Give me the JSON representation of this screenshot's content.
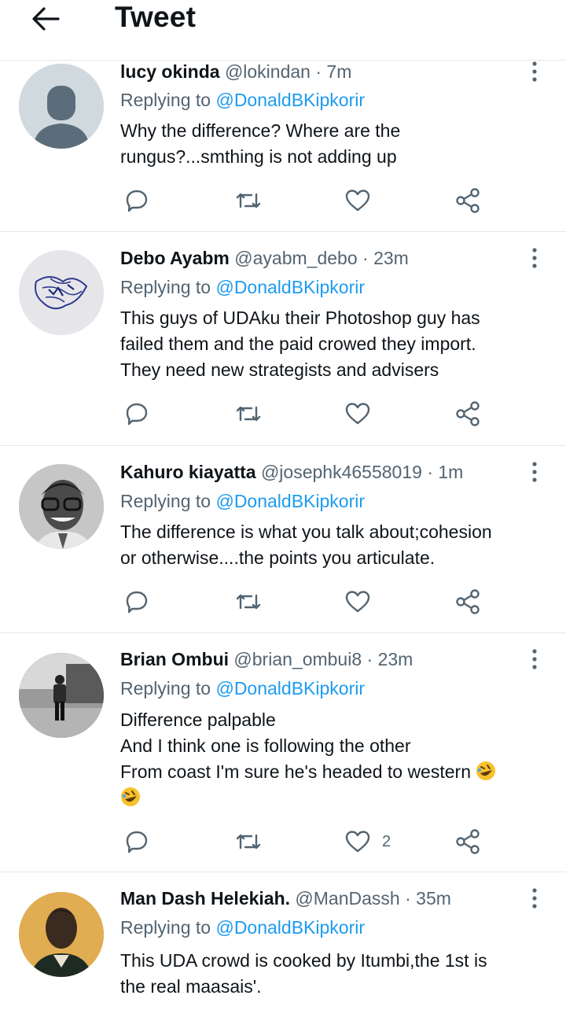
{
  "header": {
    "title": "Tweet"
  },
  "replying_label": "Replying to",
  "replies": [
    {
      "name": "lucy okinda",
      "handle": "@lokindan",
      "time": "7m",
      "replying_to": "@DonaldBKipkorir",
      "lines": [
        "Why the difference? Where are the",
        "rungus?...smthing is not adding up"
      ],
      "likes": ""
    },
    {
      "name": "Debo Ayabm",
      "handle": "@ayabm_debo",
      "time": "23m",
      "replying_to": "@DonaldBKipkorir",
      "lines": [
        "This guys of UDAku their Photoshop guy has",
        "failed them and the paid crowed they import.",
        "They need new strategists and advisers"
      ],
      "likes": ""
    },
    {
      "name": "Kahuro kiayatta",
      "handle": "@josephk46558019",
      "time": "1m",
      "replying_to": "@DonaldBKipkorir",
      "lines": [
        "The difference  is what  you  talk about;cohesion",
        "or otherwise....the  points you  articulate."
      ],
      "likes": ""
    },
    {
      "name": "Brian Ombui",
      "handle": "@brian_ombui8",
      "time": "23m",
      "replying_to": "@DonaldBKipkorir",
      "lines": [
        "Difference palpable",
        "And I think one is following the other",
        "From coast I'm sure he's headed to western",
        ""
      ],
      "likes": "2"
    },
    {
      "name": "Man Dash Helekiah.",
      "handle": "@ManDassh",
      "time": "35m",
      "replying_to": "@DonaldBKipkorir",
      "lines": [
        "This UDA crowd is cooked by Itumbi,the 1st is",
        "the real maasais'."
      ],
      "likes": ""
    }
  ],
  "icons": {
    "back": "arrow-left-icon",
    "more": "more-vertical-icon",
    "reply": "reply-icon",
    "retweet": "retweet-icon",
    "like": "heart-icon",
    "share": "share-icon",
    "emoji": "rolling-on-floor-laughing-emoji"
  },
  "colors": {
    "link": "#1d9bf0",
    "secondary": "#536471",
    "text": "#0f1419",
    "border": "#e4e7ea"
  }
}
